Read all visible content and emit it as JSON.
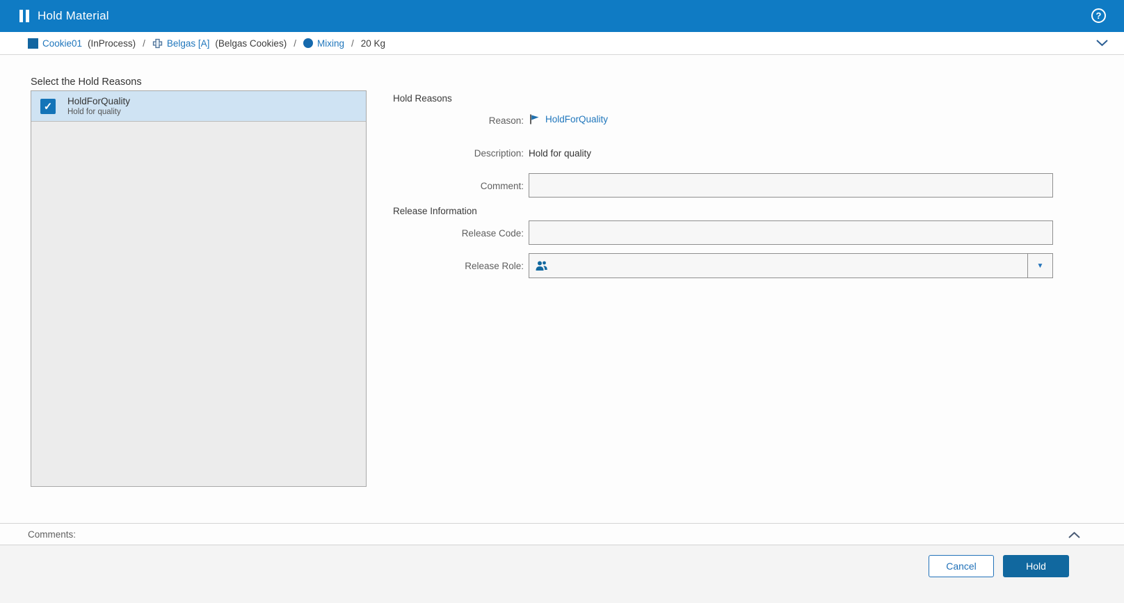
{
  "header": {
    "title": "Hold Material"
  },
  "breadcrumb": {
    "separator": "/",
    "items": [
      {
        "icon": "container-icon",
        "label": "Cookie01",
        "suffix": "(InProcess)"
      },
      {
        "icon": "equipment-icon",
        "label": "Belgas [A]",
        "suffix": "(Belgas Cookies)"
      },
      {
        "icon": "operation-icon",
        "label": "Mixing",
        "suffix": ""
      }
    ],
    "quantity": "20 Kg"
  },
  "left_panel": {
    "title": "Select the Hold Reasons",
    "items": [
      {
        "name": "HoldForQuality",
        "description": "Hold for quality",
        "checked": true
      }
    ]
  },
  "form": {
    "hold_reasons_section": "Hold Reasons",
    "reason_label": "Reason:",
    "reason_value": "HoldForQuality",
    "description_label": "Description:",
    "description_value": "Hold for quality",
    "comment_label": "Comment:",
    "comment_value": "",
    "release_section": "Release Information",
    "release_code_label": "Release Code:",
    "release_code_value": "",
    "release_role_label": "Release Role:",
    "release_role_value": ""
  },
  "comments_bar": {
    "label": "Comments:"
  },
  "footer": {
    "cancel_label": "Cancel",
    "hold_label": "Hold"
  },
  "icons": {
    "checkmark": "✓",
    "dropdown_arrow": "▼",
    "question_mark": "?"
  },
  "colors": {
    "header_blue": "#0f7bc4",
    "accent_blue": "#1f76bc",
    "button_blue": "#11689f",
    "selected_row_blue": "#cfe3f3"
  }
}
